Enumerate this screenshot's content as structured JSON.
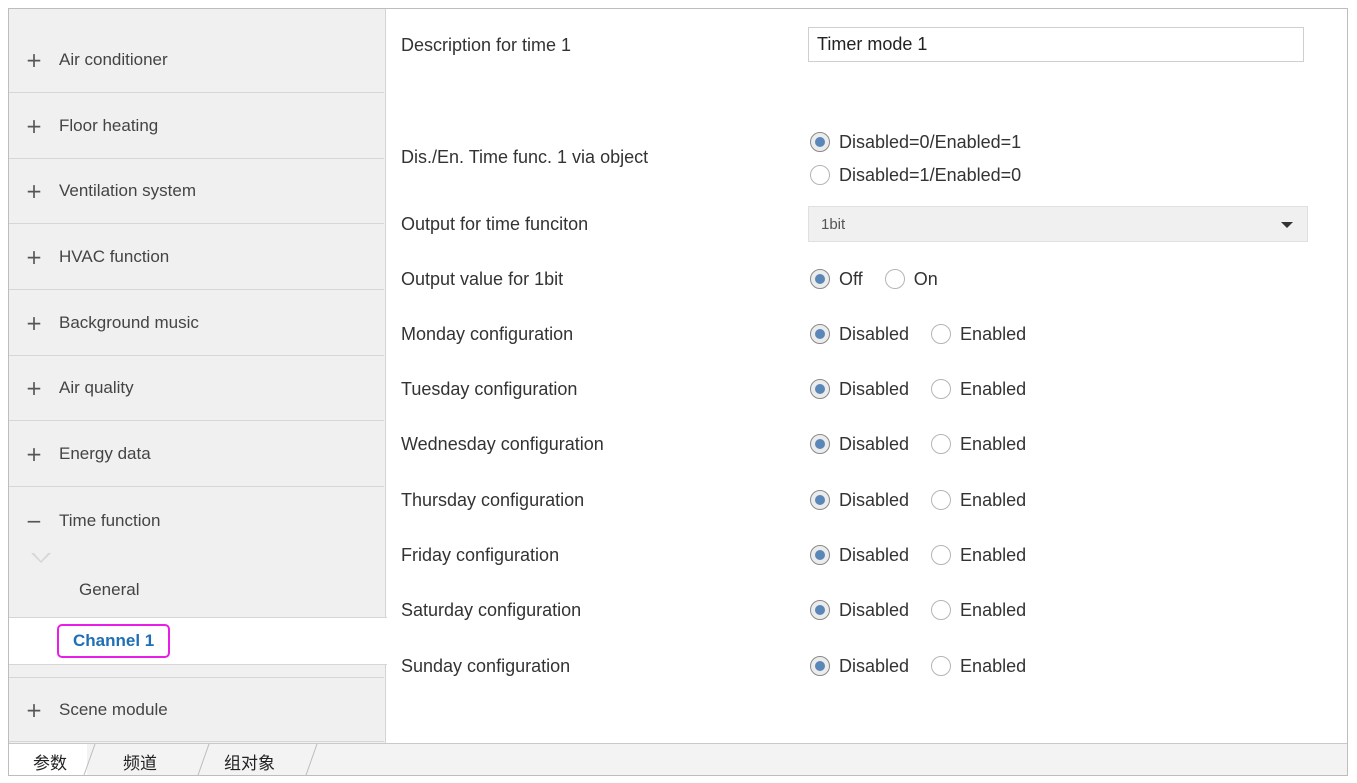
{
  "sidebar": {
    "items": [
      {
        "sign": "+",
        "label": "Air conditioner"
      },
      {
        "sign": "+",
        "label": "Floor heating"
      },
      {
        "sign": "+",
        "label": "Ventilation system"
      },
      {
        "sign": "+",
        "label": "HVAC function"
      },
      {
        "sign": "+",
        "label": "Background music"
      },
      {
        "sign": "+",
        "label": "Air quality"
      },
      {
        "sign": "+",
        "label": "Energy data"
      },
      {
        "sign": "−",
        "label": "Time function"
      }
    ],
    "subitems": [
      {
        "label": "General",
        "selected": false
      },
      {
        "label": "Channel 1",
        "selected": true
      }
    ],
    "after": {
      "sign": "+",
      "label": "Scene module"
    },
    "highlight_color": "#e81ee8",
    "selected_text_color": "#1e6fb5"
  },
  "params": {
    "description": {
      "label": "Description for time 1",
      "value": "Timer mode 1"
    },
    "dis_en": {
      "label": "Dis./En. Time func. 1 via object",
      "options": [
        "Disabled=0/Enabled=1",
        "Disabled=1/Enabled=0"
      ],
      "selected": 0
    },
    "output": {
      "label": "Output for time funciton",
      "value": "1bit"
    },
    "output_value": {
      "label": "Output value for 1bit",
      "options": [
        "Off",
        "On"
      ],
      "selected": 0
    },
    "days": [
      {
        "label": "Monday configuration"
      },
      {
        "label": "Tuesday configuration"
      },
      {
        "label": "Wednesday configuration"
      },
      {
        "label": "Thursday configuration"
      },
      {
        "label": "Friday configuration"
      },
      {
        "label": "Saturday configuration"
      },
      {
        "label": "Sunday configuration"
      }
    ],
    "day_options": [
      "Disabled",
      "Enabled"
    ],
    "day_selected": 0,
    "radio_accent": "#5a86b8"
  },
  "tabs": [
    {
      "label": "参数",
      "active": true
    },
    {
      "label": "频道",
      "active": false
    },
    {
      "label": "组对象",
      "active": false
    }
  ]
}
